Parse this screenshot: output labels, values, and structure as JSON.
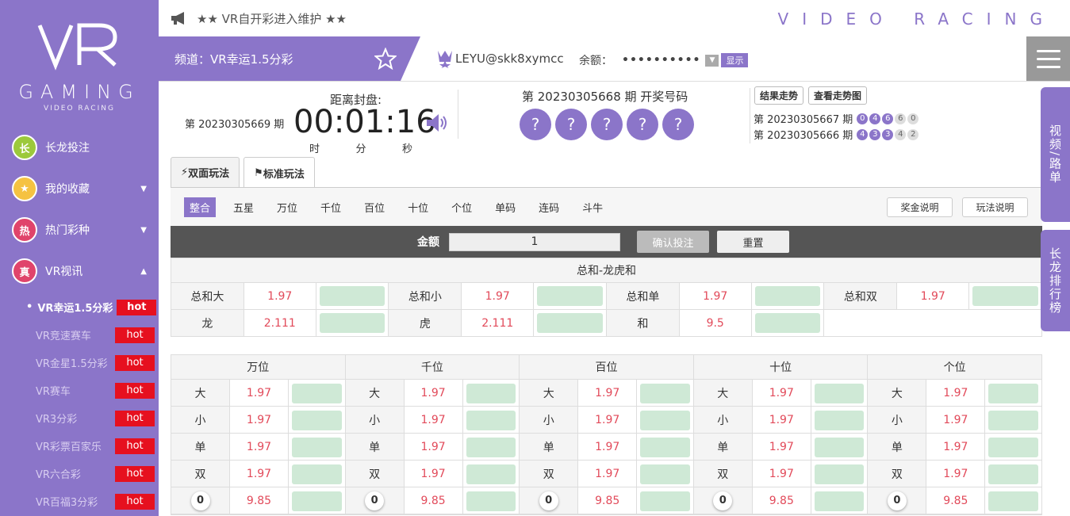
{
  "sidebar": {
    "logo_sub1": "GAMING",
    "logo_sub2": "VIDEO RACING",
    "menu": [
      {
        "label": "长龙投注",
        "icon": "长"
      },
      {
        "label": "我的收藏",
        "icon": "★"
      },
      {
        "label": "热门彩种",
        "icon": "热"
      },
      {
        "label": "VR视讯",
        "icon": "真"
      }
    ],
    "games": [
      {
        "label": "VR幸运1.5分彩"
      },
      {
        "label": "VR竞速赛车"
      },
      {
        "label": "VR金星1.5分彩"
      },
      {
        "label": "VR赛车"
      },
      {
        "label": "VR3分彩"
      },
      {
        "label": "VR彩票百家乐"
      },
      {
        "label": "VR六合彩"
      },
      {
        "label": "VR百福3分彩"
      }
    ],
    "hot": "hot"
  },
  "topbar": {
    "notice": "★★ VR自开彩进入维护 ★★",
    "brand": "VIDEO RACING"
  },
  "channel": {
    "label": "频道：VR幸运1.5分彩",
    "user": "LEYU@skk8xymcc",
    "balance_label": "余额：",
    "balance_mask": "••••••••••",
    "show": "显示"
  },
  "draw": {
    "current_issue": "第 20230305669 期",
    "fengpan": "距离封盘:",
    "timer": "00:01:16",
    "units": [
      "时",
      "分",
      "秒"
    ],
    "prev_label": "第 20230305668 期  开奖号码",
    "balls": [
      "?",
      "?",
      "?",
      "?",
      "?"
    ],
    "btn_result": "结果走势",
    "btn_chart": "查看走势图",
    "history": [
      {
        "issue": "第 20230305667 期",
        "nums": [
          "0",
          "4",
          "6",
          "6",
          "0"
        ]
      },
      {
        "issue": "第 20230305666 期",
        "nums": [
          "4",
          "3",
          "3",
          "4",
          "2"
        ]
      }
    ]
  },
  "tabs": [
    "双面玩法",
    "标准玩法"
  ],
  "subtabs": [
    "整合",
    "五星",
    "万位",
    "千位",
    "百位",
    "十位",
    "个位",
    "单码",
    "连码",
    "斗牛"
  ],
  "right_btns": [
    "奖金说明",
    "玩法说明"
  ],
  "amount": {
    "label": "金额",
    "value": "1",
    "confirm": "确认投注",
    "reset": "重置"
  },
  "summary": {
    "title": "总和-龙虎和",
    "row1": [
      {
        "l": "总和大",
        "o": "1.97"
      },
      {
        "l": "总和小",
        "o": "1.97"
      },
      {
        "l": "总和单",
        "o": "1.97"
      },
      {
        "l": "总和双",
        "o": "1.97"
      }
    ],
    "row2": [
      {
        "l": "龙",
        "o": "2.111"
      },
      {
        "l": "虎",
        "o": "2.111"
      },
      {
        "l": "和",
        "o": "9.5"
      }
    ]
  },
  "positions": [
    "万位",
    "千位",
    "百位",
    "十位",
    "个位"
  ],
  "pos_rows": [
    {
      "l": "大",
      "o": "1.97"
    },
    {
      "l": "小",
      "o": "1.97"
    },
    {
      "l": "单",
      "o": "1.97"
    },
    {
      "l": "双",
      "o": "1.97"
    },
    {
      "l": "0",
      "o": "9.85"
    }
  ],
  "side": {
    "tab1": "视频/路单",
    "tab2": "长龙排行榜"
  }
}
